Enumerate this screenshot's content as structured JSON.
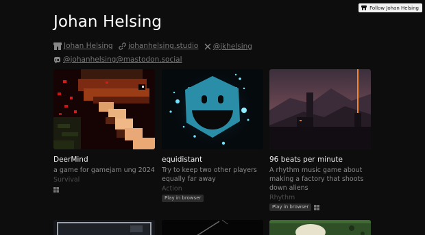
{
  "follow_button": {
    "label": "Follow Johan Helsing",
    "icon": "itchio-icon"
  },
  "profile": {
    "name": "Johan Helsing",
    "links": [
      {
        "icon": "itchio-icon",
        "text": "Johan Helsing"
      },
      {
        "icon": "link-icon",
        "text": "johanhelsing.studio"
      },
      {
        "icon": "x-icon",
        "text": "@jkhelsing"
      },
      {
        "icon": "mastodon-icon",
        "text": "@johanhelsing@mastodon.social"
      }
    ]
  },
  "games": [
    {
      "title": "DeerMind",
      "description": "a game for gamejam ung 2024",
      "genre": "Survival",
      "play_in_browser": "",
      "platforms": [
        "windows"
      ]
    },
    {
      "title": "equidistant",
      "description": "Try to keep two other players equally far away",
      "genre": "Action",
      "play_in_browser": "Play in browser",
      "platforms": []
    },
    {
      "title": "96 beats per minute",
      "description": "A rhythm music game about making a factory that shoots down aliens",
      "genre": "Rhythm",
      "play_in_browser": "Play in browser",
      "platforms": [
        "windows"
      ]
    }
  ],
  "colors": {
    "background": "#0d0d0d",
    "text": "#e6e6e6",
    "muted": "#8a8a8a"
  }
}
